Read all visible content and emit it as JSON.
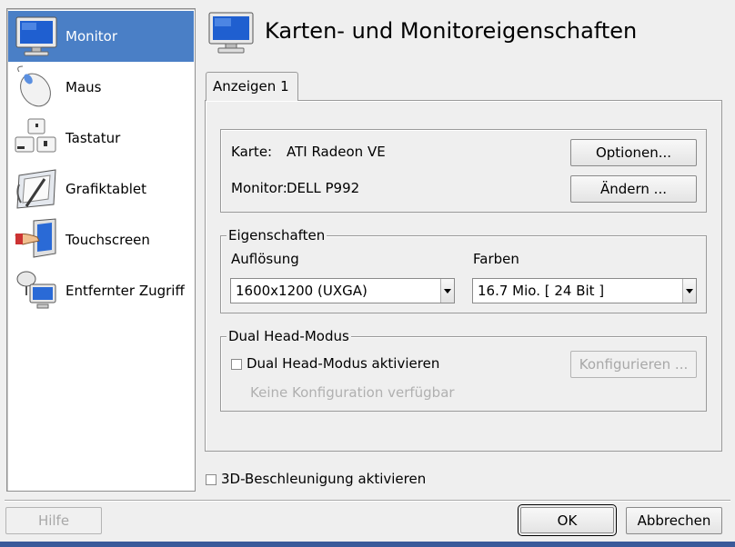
{
  "sidebar": {
    "items": [
      {
        "label": "Monitor",
        "icon": "monitor-icon",
        "active": true
      },
      {
        "label": "Maus",
        "icon": "mouse-icon"
      },
      {
        "label": "Tastatur",
        "icon": "keyboard-icon"
      },
      {
        "label": "Grafiktablet",
        "icon": "tablet-icon"
      },
      {
        "label": "Touchscreen",
        "icon": "touchscreen-icon"
      },
      {
        "label": "Entfernter Zugriff",
        "icon": "remote-access-icon"
      }
    ]
  },
  "header": {
    "title": "Karten- und Monitoreigenschaften",
    "icon": "monitor-icon"
  },
  "tabs": [
    {
      "label": "Anzeigen 1"
    }
  ],
  "card": {
    "karte_label": "Karte:",
    "karte_value": "ATI Radeon VE",
    "monitor_label": "Monitor:",
    "monitor_value": "DELL P992",
    "options_button": "Optionen...",
    "change_button": "Ändern ..."
  },
  "properties": {
    "legend": "Eigenschaften",
    "resolution_label": "Auflösung",
    "resolution_value": "1600x1200 (UXGA)",
    "colors_label": "Farben",
    "colors_value": "16.7 Mio. [ 24 Bit ]"
  },
  "dualhead": {
    "legend": "Dual Head-Modus",
    "checkbox_label": "Dual Head-Modus aktivieren",
    "checked": false,
    "configure_button": "Konfigurieren ...",
    "note": "Keine Konfiguration verfügbar"
  },
  "accel": {
    "checkbox_label": "3D-Beschleunigung aktivieren",
    "checked": false
  },
  "footer": {
    "help_button": "Hilfe",
    "ok_button": "OK",
    "cancel_button": "Abbrechen"
  },
  "colors": {
    "selection": "#4a7fc6",
    "window_bg": "#efefef"
  }
}
